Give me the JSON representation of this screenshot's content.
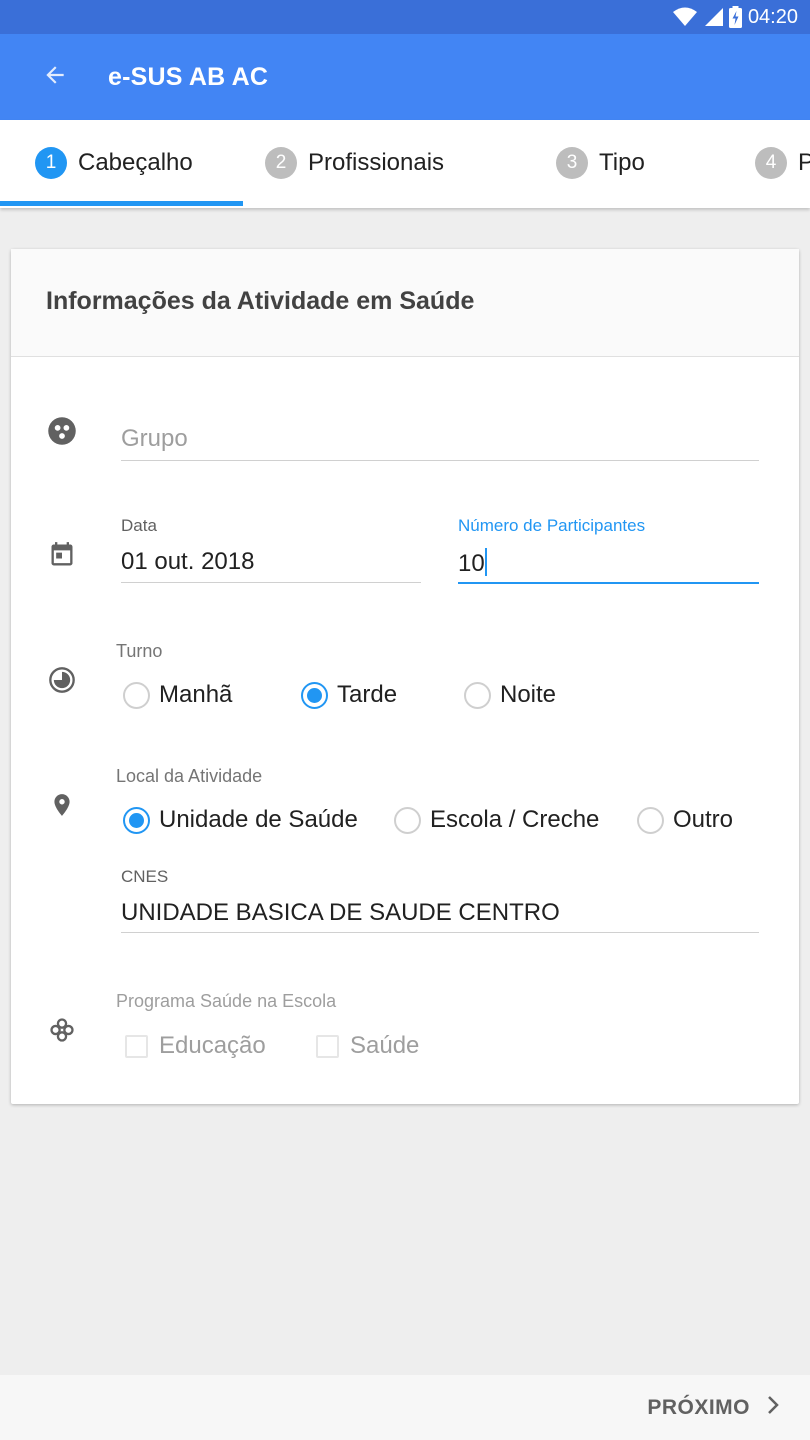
{
  "status_bar": {
    "time": "04:20",
    "icons": [
      "wifi-icon",
      "cell-signal-icon",
      "battery-charging-icon"
    ]
  },
  "app_bar": {
    "back_icon": "arrow-back-icon",
    "title": "e-SUS AB AC"
  },
  "stepper": {
    "tabs": [
      {
        "number": "1",
        "label": "Cabeçalho",
        "active": true
      },
      {
        "number": "2",
        "label": "Profissionais",
        "active": false
      },
      {
        "number": "3",
        "label": "Tipo",
        "active": false
      },
      {
        "number": "4",
        "label": "P",
        "active": false
      }
    ]
  },
  "form": {
    "title": "Informações da Atividade em Saúde",
    "grupo": {
      "icon": "group-icon",
      "placeholder": "Grupo"
    },
    "data": {
      "icon": "calendar-icon",
      "label": "Data",
      "value": "01 out. 2018"
    },
    "participantes": {
      "label": "Número de Participantes",
      "value": "10"
    },
    "turno": {
      "icon": "clock-icon",
      "label": "Turno",
      "options": [
        "Manhã",
        "Tarde",
        "Noite"
      ],
      "selected": "Tarde"
    },
    "local": {
      "icon": "location-pin-icon",
      "label": "Local da Atividade",
      "options": [
        "Unidade de Saúde",
        "Escola / Creche",
        "Outro"
      ],
      "selected": "Unidade de Saúde"
    },
    "cnes": {
      "label": "CNES",
      "value": "UNIDADE BASICA DE SAUDE CENTRO"
    },
    "pse": {
      "icon": "flower-icon",
      "label": "Programa Saúde na Escola",
      "options": [
        "Educação",
        "Saúde"
      ]
    }
  },
  "footer": {
    "next_label": "PRÓXIMO",
    "next_icon": "chevron-right-icon"
  },
  "colors": {
    "primary": "#4285f4",
    "status_bar": "#3a6fd8",
    "accent": "#2196f3"
  }
}
